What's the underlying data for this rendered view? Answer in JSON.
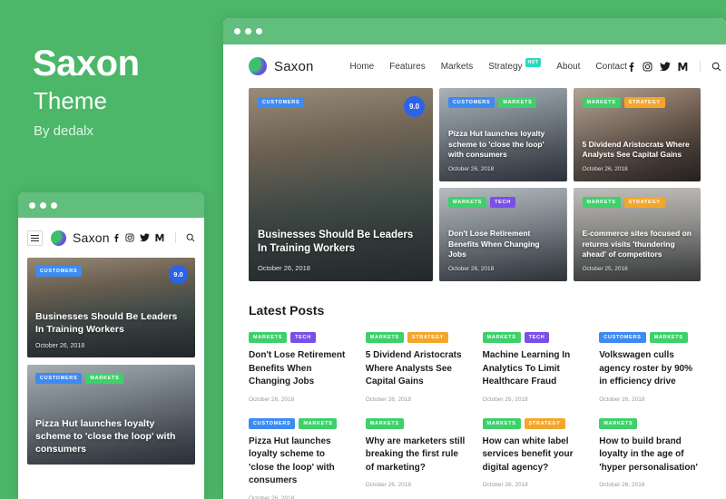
{
  "promo": {
    "title": "Saxon",
    "subtitle": "Theme",
    "author": "By dedalx",
    "background_color": "#4CB669"
  },
  "colors": {
    "brand_green": "#4CB669",
    "tag_customers": "#3D8BF2",
    "tag_markets": "#3ED06B",
    "tag_strategy": "#F2A72C",
    "tag_tech": "#7A4FE8",
    "badge_hot": "#28D9C2",
    "score_blue": "#2A63E8"
  },
  "desktop": {
    "brand": "Saxon",
    "nav": [
      {
        "label": "Home",
        "badge": ""
      },
      {
        "label": "Features",
        "badge": ""
      },
      {
        "label": "Markets",
        "badge": ""
      },
      {
        "label": "Strategy",
        "badge": "HOT"
      },
      {
        "label": "About",
        "badge": ""
      },
      {
        "label": "Contact",
        "badge": ""
      }
    ],
    "social": [
      "facebook-icon",
      "instagram-icon",
      "twitter-icon",
      "medium-icon"
    ],
    "search_icon": "search-icon",
    "hero_cards": [
      {
        "tags": [
          {
            "label": "CUSTOMERS",
            "class": "t-customers"
          }
        ],
        "title": "Businesses Should Be Leaders In Training Workers",
        "date": "October 26, 2018",
        "score": "9.0"
      },
      {
        "tags": [
          {
            "label": "CUSTOMERS",
            "class": "t-customers"
          },
          {
            "label": "MARKETS",
            "class": "t-markets"
          }
        ],
        "title": "Pizza Hut launches loyalty scheme to 'close the loop' with consumers",
        "date": "October 26, 2018",
        "score": ""
      },
      {
        "tags": [
          {
            "label": "MARKETS",
            "class": "t-markets"
          },
          {
            "label": "STRATEGY",
            "class": "t-strategy"
          }
        ],
        "title": "5 Dividend Aristocrats Where Analysts See Capital Gains",
        "date": "October 26, 2018",
        "score": ""
      },
      {
        "tags": [
          {
            "label": "MARKETS",
            "class": "t-markets"
          },
          {
            "label": "TECH",
            "class": "t-tech"
          }
        ],
        "title": "Don't Lose Retirement Benefits When Changing Jobs",
        "date": "October 26, 2018",
        "score": ""
      },
      {
        "tags": [
          {
            "label": "MARKETS",
            "class": "t-markets"
          },
          {
            "label": "STRATEGY",
            "class": "t-strategy"
          }
        ],
        "title": "E-commerce sites focused on returns visits 'thundering ahead' of competitors",
        "date": "October 25, 2018",
        "score": ""
      }
    ],
    "latest_posts_heading": "Latest Posts",
    "latest_posts": [
      {
        "tags": [
          {
            "label": "MARKETS",
            "class": "t-markets"
          },
          {
            "label": "TECH",
            "class": "t-tech"
          }
        ],
        "title": "Don't Lose Retirement Benefits When Changing Jobs",
        "date": "October 26, 2018"
      },
      {
        "tags": [
          {
            "label": "MARKETS",
            "class": "t-markets"
          },
          {
            "label": "STRATEGY",
            "class": "t-strategy"
          }
        ],
        "title": "5 Dividend Aristocrats Where Analysts See Capital Gains",
        "date": "October 26, 2018"
      },
      {
        "tags": [
          {
            "label": "MARKETS",
            "class": "t-markets"
          },
          {
            "label": "TECH",
            "class": "t-tech"
          }
        ],
        "title": "Machine Learning In Analytics To Limit Healthcare Fraud",
        "date": "October 26, 2018"
      },
      {
        "tags": [
          {
            "label": "CUSTOMERS",
            "class": "t-customers"
          },
          {
            "label": "MARKETS",
            "class": "t-markets"
          }
        ],
        "title": "Volkswagen culls agency roster by 90% in efficiency drive",
        "date": "October 26, 2018"
      },
      {
        "tags": [
          {
            "label": "CUSTOMERS",
            "class": "t-customers"
          },
          {
            "label": "MARKETS",
            "class": "t-markets"
          }
        ],
        "title": "Pizza Hut launches loyalty scheme to 'close the loop' with consumers",
        "date": "October 26, 2018"
      },
      {
        "tags": [
          {
            "label": "MARKETS",
            "class": "t-markets"
          }
        ],
        "title": "Why are marketers still breaking the first rule of marketing?",
        "date": "October 26, 2018"
      },
      {
        "tags": [
          {
            "label": "MARKETS",
            "class": "t-markets"
          },
          {
            "label": "STRATEGY",
            "class": "t-strategy"
          }
        ],
        "title": "How can white label services benefit your digital agency?",
        "date": "October 26, 2018"
      },
      {
        "tags": [
          {
            "label": "MARKETS",
            "class": "t-markets"
          }
        ],
        "title": "How to build brand loyalty in the age of 'hyper personalisation'",
        "date": "October 26, 2018"
      }
    ]
  },
  "mobile": {
    "brand": "Saxon",
    "menu_icon": "hamburger-icon",
    "social": [
      "facebook-icon",
      "instagram-icon",
      "twitter-icon",
      "medium-icon"
    ],
    "search_icon": "search-icon",
    "cards": [
      {
        "tags": [
          {
            "label": "CUSTOMERS",
            "class": "t-customers"
          }
        ],
        "title": "Businesses Should Be Leaders In Training Workers",
        "date": "October 26, 2018",
        "score": "9.0"
      },
      {
        "tags": [
          {
            "label": "CUSTOMERS",
            "class": "t-customers"
          },
          {
            "label": "MARKETS",
            "class": "t-markets"
          }
        ],
        "title": "Pizza Hut launches loyalty scheme to 'close the loop' with consumers",
        "date": "",
        "score": ""
      }
    ]
  }
}
